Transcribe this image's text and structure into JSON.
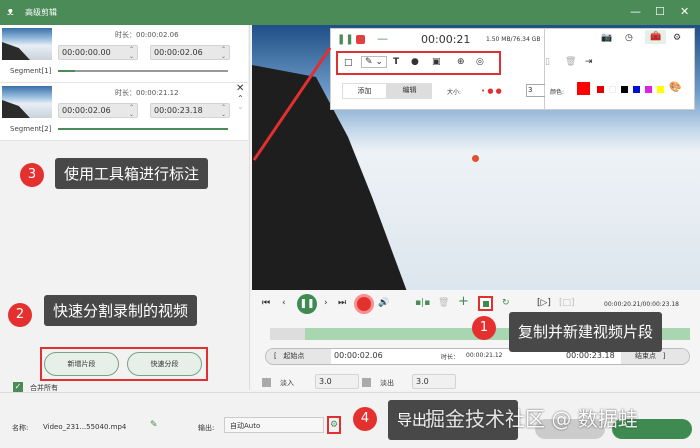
{
  "window": {
    "title": "高级剪辑",
    "minimize": "—",
    "maximize": "☐",
    "close": "✕"
  },
  "segments": [
    {
      "label": "Segment[1]",
      "duration_label": "时长：00:00:02.06",
      "start": "00:00:00.00",
      "end": "00:00:02.06",
      "progress": 0.1
    },
    {
      "label": "Segment[2]",
      "duration_label": "时长：00:00:21.12",
      "start": "00:00:02.06",
      "end": "00:00:23.18",
      "progress": 1.0
    }
  ],
  "recorder": {
    "time": "00:00:21",
    "storage": "1.50 MB/76.34 GB",
    "tab_add": "添加",
    "tab_edit": "编辑",
    "size_label": "大小:",
    "size_value": "3",
    "color_label": "颜色:",
    "colors": [
      "#ff0000",
      "#e00000",
      "#ffffff",
      "#000000",
      "#0010d0",
      "#e020e0",
      "#ffff00"
    ]
  },
  "player": {
    "time": "00:00:20.21/00:00:23.18",
    "progress": 0.87
  },
  "trim": {
    "start_btn": "起始点",
    "start": "00:00:02.06",
    "duration_label": "时长：",
    "duration": "00:00:21.12",
    "end": "00:00:23.18",
    "end_btn": "结束点",
    "fade_in": "淡入",
    "fade_in_val": "3.0",
    "fade_out": "淡出",
    "fade_out_val": "3.0"
  },
  "left_actions": {
    "new_segment": "新增片段",
    "quick_split": "快速分段",
    "merge_all": "合并所有"
  },
  "bottom": {
    "name_label": "名称:",
    "name": "Video_231...55040.mp4",
    "output_label": "输出:",
    "output": "自动Auto"
  },
  "annotations": [
    {
      "num": "1",
      "text": "复制并新建视频片段"
    },
    {
      "num": "2",
      "text": "快速分割录制的视频"
    },
    {
      "num": "3",
      "text": "使用工具箱进行标注"
    },
    {
      "num": "4",
      "text": "导出"
    }
  ],
  "watermark": "掘金技术社区 @ 数据蛙"
}
